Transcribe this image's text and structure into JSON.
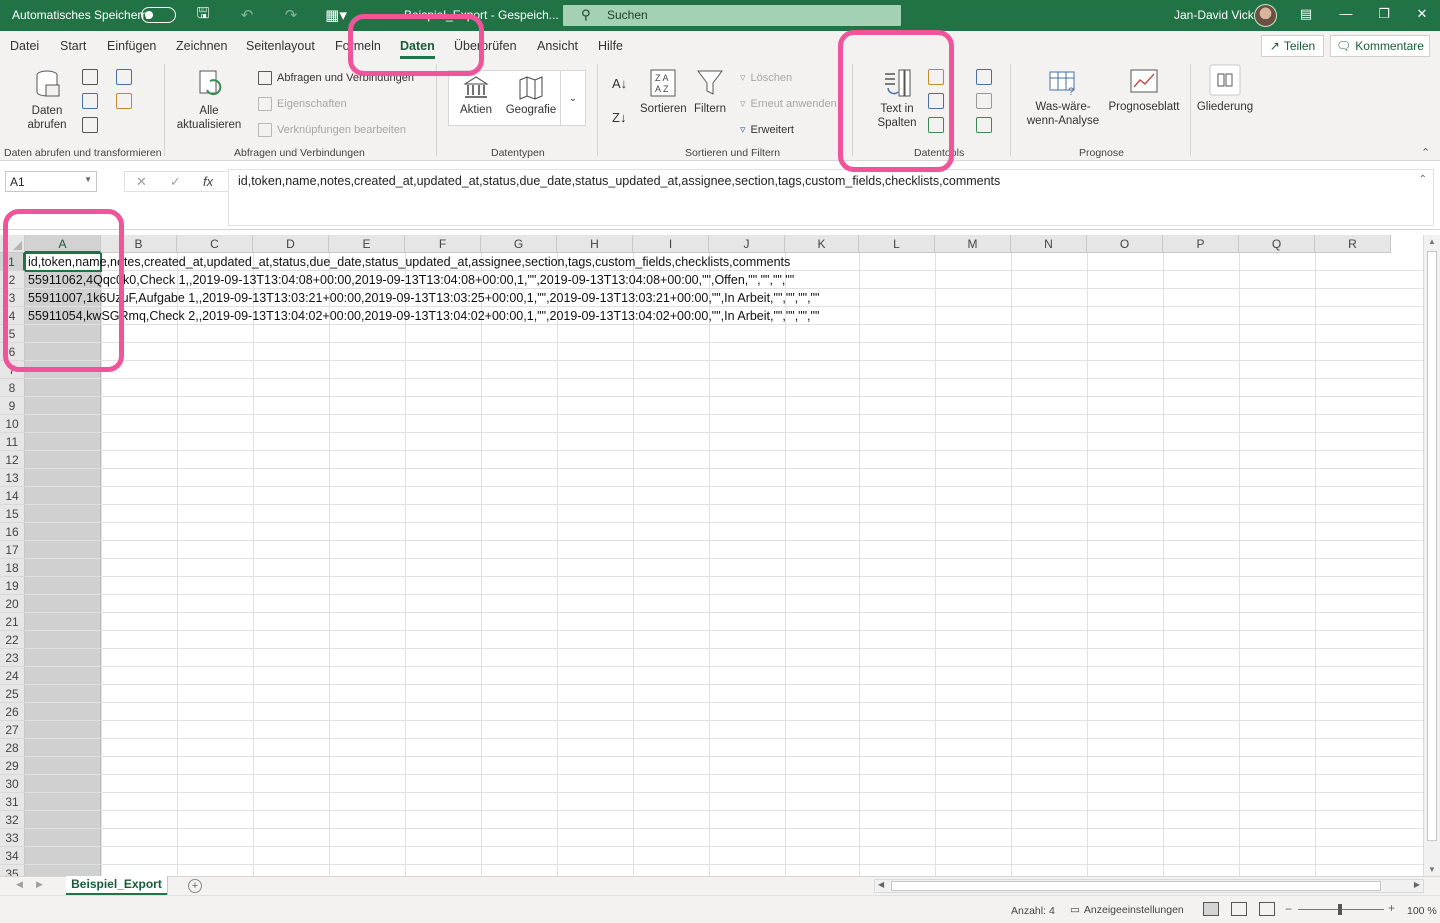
{
  "titlebar": {
    "autosave_label": "Automatisches Speichern",
    "doc_title": "Beispiel_Export  -  Gespeich...",
    "search_placeholder": "Suchen",
    "user_name": "Jan-David Vick"
  },
  "ribbon_tabs": [
    "Datei",
    "Start",
    "Einfügen",
    "Zeichnen",
    "Seitenlayout",
    "Formeln",
    "Daten",
    "Überprüfen",
    "Ansicht",
    "Hilfe"
  ],
  "active_tab": "Daten",
  "share_label": "Teilen",
  "comments_label": "Kommentare",
  "groups": {
    "get_data": {
      "label": "Daten abrufen und transformieren",
      "get_data_btn": "Daten abrufen"
    },
    "queries": {
      "label": "Abfragen und Verbindungen",
      "refresh_all": "Alle aktualisieren",
      "queries_connections": "Abfragen und Verbindungen",
      "properties": "Eigenschaften",
      "edit_links": "Verknüpfungen bearbeiten"
    },
    "datatypes": {
      "label": "Datentypen",
      "stocks": "Aktien",
      "geography": "Geografie"
    },
    "sort_filter": {
      "label": "Sortieren und Filtern",
      "sort": "Sortieren",
      "filter": "Filtern",
      "clear": "Löschen",
      "reapply": "Erneut anwenden",
      "advanced": "Erweitert"
    },
    "data_tools": {
      "label": "Datentools",
      "text_to_columns": "Text in Spalten"
    },
    "forecast": {
      "label": "Prognose",
      "whatif": "Was-wäre-wenn-Analyse",
      "forecast_sheet": "Prognoseblatt"
    },
    "outline": {
      "label": "Gliederung"
    }
  },
  "formula_bar": {
    "name_box": "A1",
    "fx_label": "fx",
    "content": "id,token,name,notes,created_at,updated_at,status,due_date,status_updated_at,assignee,section,tags,custom_fields,checklists,comments"
  },
  "columns": [
    "A",
    "B",
    "C",
    "D",
    "E",
    "F",
    "G",
    "H",
    "I",
    "J",
    "K",
    "L",
    "M",
    "N",
    "O",
    "P",
    "Q",
    "R"
  ],
  "rows": [
    "1",
    "2",
    "3",
    "4",
    "5",
    "6",
    "7",
    "8",
    "9",
    "10",
    "11",
    "12",
    "13",
    "14",
    "15",
    "16",
    "17",
    "18",
    "19",
    "20",
    "21",
    "22",
    "23",
    "24",
    "25",
    "26",
    "27",
    "28",
    "29",
    "30",
    "31",
    "32",
    "33",
    "34",
    "35"
  ],
  "cells": [
    "id,token,name,notes,created_at,updated_at,status,due_date,status_updated_at,assignee,section,tags,custom_fields,checklists,comments",
    "55911062,4Qqc0k0,Check 1,,2019-09-13T13:04:08+00:00,2019-09-13T13:04:08+00:00,1,\"\",2019-09-13T13:04:08+00:00,\"\",Offen,\"\",\"\",\"\",\"\"",
    "55911007,1k6UzuF,Aufgabe 1,,2019-09-13T13:03:21+00:00,2019-09-13T13:03:25+00:00,1,\"\",2019-09-13T13:03:21+00:00,\"\",In Arbeit,\"\",\"\",\"\",\"\"",
    "55911054,kwSGRmq,Check 2,,2019-09-13T13:04:02+00:00,2019-09-13T13:04:02+00:00,1,\"\",2019-09-13T13:04:02+00:00,\"\",In Arbeit,\"\",\"\",\"\",\"\""
  ],
  "sheet_tab": "Beispiel_Export",
  "status": {
    "count": "Anzahl: 4",
    "display_settings": "Anzeigeeinstellungen",
    "zoom": "100 %"
  },
  "highlight_color": "#f0559c",
  "accent_color": "#217346"
}
